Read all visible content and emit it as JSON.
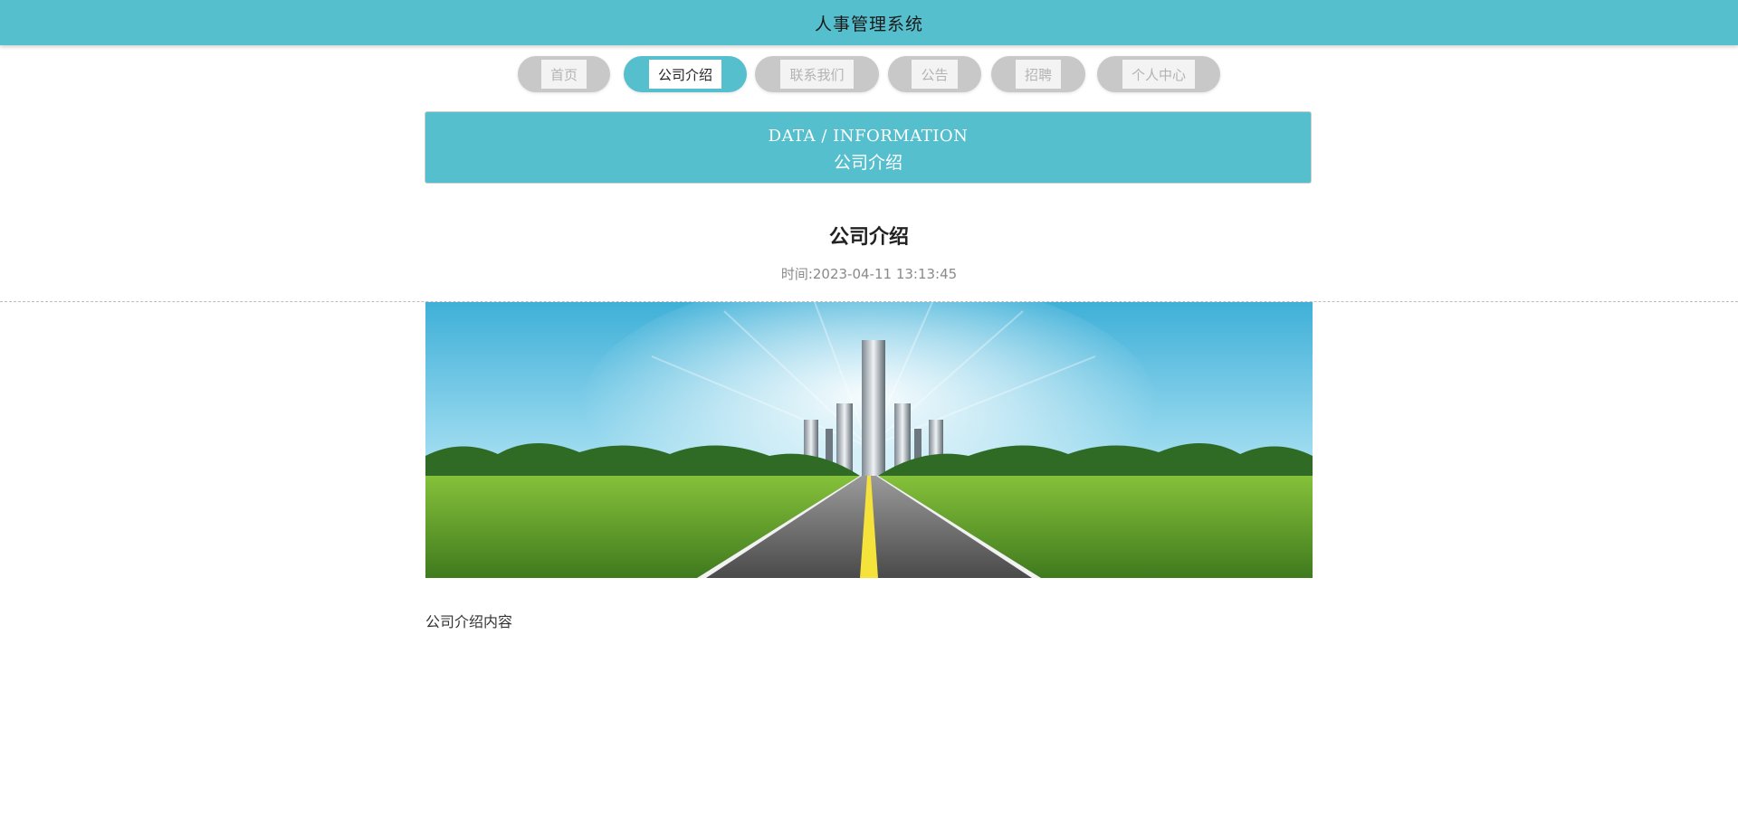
{
  "header": {
    "title": "人事管理系统"
  },
  "nav": {
    "items": [
      {
        "label": "首页",
        "active": false
      },
      {
        "label": "公司介绍",
        "active": true
      },
      {
        "label": "联系我们",
        "active": false
      },
      {
        "label": "公告",
        "active": false
      },
      {
        "label": "招聘",
        "active": false
      },
      {
        "label": "个人中心",
        "active": false
      }
    ]
  },
  "banner": {
    "en": "DATA / INFORMATION",
    "cn": "公司介绍"
  },
  "article": {
    "title": "公司介绍",
    "time_label": "时间:",
    "time_value": "2023-04-11 13:13:45",
    "content": "公司介绍内容"
  },
  "colors": {
    "accent": "#55bfcd",
    "nav_inactive": "#c8c8c8"
  }
}
